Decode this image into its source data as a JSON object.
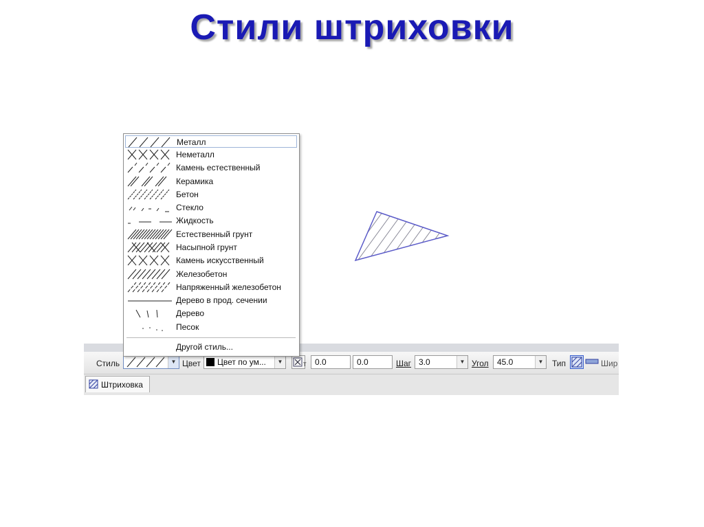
{
  "slide": {
    "title": "Стили штриховки"
  },
  "dropdown": {
    "items": [
      {
        "label": "Металл",
        "pattern": "metal-icon"
      },
      {
        "label": "Неметалл",
        "pattern": "nonmetal-icon"
      },
      {
        "label": "Камень естественный",
        "pattern": "natural-stone-icon"
      },
      {
        "label": "Керамика",
        "pattern": "ceramic-icon"
      },
      {
        "label": "Бетон",
        "pattern": "concrete-icon"
      },
      {
        "label": "Стекло",
        "pattern": "glass-icon"
      },
      {
        "label": "Жидкость",
        "pattern": "liquid-icon"
      },
      {
        "label": "Естественный грунт",
        "pattern": "natural-soil-icon"
      },
      {
        "label": "Насыпной грунт",
        "pattern": "fill-soil-icon"
      },
      {
        "label": "Камень искусственный",
        "pattern": "artificial-stone-icon"
      },
      {
        "label": "Железобетон",
        "pattern": "reinforced-concrete-icon"
      },
      {
        "label": "Напряженный железобетон",
        "pattern": "prestressed-concrete-icon"
      },
      {
        "label": "Дерево в прод. сечении",
        "pattern": "wood-long-section-icon"
      },
      {
        "label": "Дерево",
        "pattern": "wood-icon"
      },
      {
        "label": "Песок",
        "pattern": "sand-icon"
      }
    ],
    "selected_index": 0,
    "other_style": "Другой стиль..."
  },
  "toolbar": {
    "style_label": "Стиль",
    "color_label": "Цвет",
    "color_value": "Цвет по ум...",
    "color_swatch": "#000000",
    "t_label": "т",
    "x_value": "0.0",
    "y_value": "0.0",
    "step_label": "Шаг",
    "step_value": "3.0",
    "angle_label": "Угол",
    "angle_value": "45.0",
    "type_label": "Тип",
    "width_label": "Шир"
  },
  "tabs": [
    {
      "label": "Штриховка"
    }
  ],
  "colors": {
    "title": "#1a1ab4",
    "hatch_outline": "#5a5ac8",
    "hatch_lines": "#8c8c9a"
  }
}
